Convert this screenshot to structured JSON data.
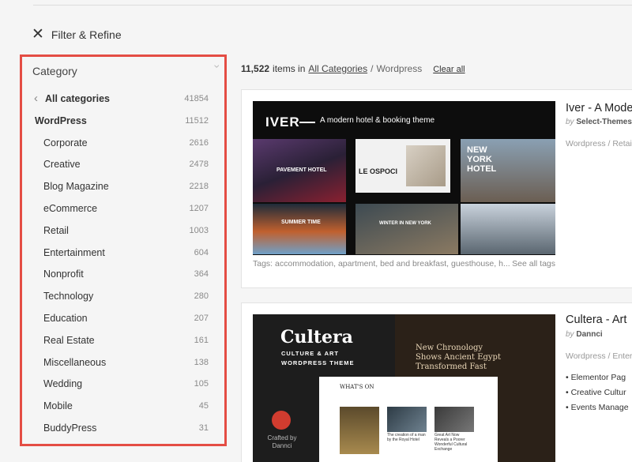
{
  "filter": {
    "label": "Filter & Refine"
  },
  "category_panel": {
    "title": "Category",
    "all": {
      "label": "All categories",
      "count": "41854"
    },
    "parent": {
      "label": "WordPress",
      "count": "11512"
    },
    "items": [
      {
        "label": "Corporate",
        "count": "2616"
      },
      {
        "label": "Creative",
        "count": "2478"
      },
      {
        "label": "Blog Magazine",
        "count": "2218"
      },
      {
        "label": "eCommerce",
        "count": "1207"
      },
      {
        "label": "Retail",
        "count": "1003"
      },
      {
        "label": "Entertainment",
        "count": "604"
      },
      {
        "label": "Nonprofit",
        "count": "364"
      },
      {
        "label": "Technology",
        "count": "280"
      },
      {
        "label": "Education",
        "count": "207"
      },
      {
        "label": "Real Estate",
        "count": "161"
      },
      {
        "label": "Miscellaneous",
        "count": "138"
      },
      {
        "label": "Wedding",
        "count": "105"
      },
      {
        "label": "Mobile",
        "count": "45"
      },
      {
        "label": "BuddyPress",
        "count": "31"
      }
    ]
  },
  "results": {
    "count": "11,522",
    "items_in": "items in",
    "all_categories_link": "All Categories",
    "separator": "/",
    "current": "Wordpress",
    "clear_all": "Clear all"
  },
  "cards": [
    {
      "title": "Iver - A Mode",
      "by_prefix": "by",
      "author": "Select-Themes",
      "category": "Wordpress / Retail",
      "tags": "Tags: accommodation, apartment, bed and breakfast, guesthouse, h...",
      "see_all_tags": "See all tags",
      "thumb": {
        "logo": "IVER",
        "tagline": "A modern hotel & booking theme",
        "shot_labels": [
          "PAVEMENT HOTEL",
          "LE OSPOCI",
          "NEW YORK HOTEL",
          "SUMMER TIME",
          "WINTER IN NEW YORK"
        ]
      }
    },
    {
      "title": "Cultera - Art",
      "by_prefix": "by",
      "author": "Dannci",
      "category": "Wordpress / Enter",
      "features": [
        "Elementor Pag",
        "Creative Cultur",
        "Events Manage"
      ],
      "thumb": {
        "logo": "Cultera",
        "subtitle": "CULTURE & ART WORDPRESS THEME",
        "headline": "New Chronology Shows Ancient Egypt Transformed Fast",
        "whats_on": "WHAT'S ON",
        "crafted_by": "Crafted by Dannci",
        "captions": [
          "The creation of a man by the Royal Hotel",
          "Great Art Now Reveals a Poorer Wonderful Cultural Exchange"
        ]
      }
    }
  ],
  "colors": {
    "highlight_border": "#e44d44",
    "background": "#f5f5f5"
  }
}
